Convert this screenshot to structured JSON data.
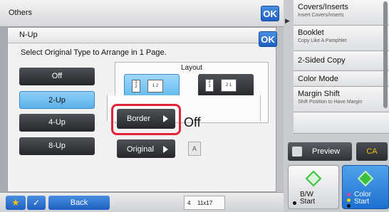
{
  "others_bar": {
    "title": "Others",
    "ok_label": "OK"
  },
  "right_panel": {
    "items": [
      {
        "label": "Covers/Inserts",
        "sublabel": "Insert Covers/Inserts"
      },
      {
        "label": "Booklet",
        "sublabel": "Copy Like A Pamphlet"
      },
      {
        "label": "2-Sided Copy",
        "sublabel": ""
      },
      {
        "label": "Color Mode",
        "sublabel": ""
      },
      {
        "label": "Margin Shift",
        "sublabel": "Shift Position to Have Margin"
      },
      {
        "label": "",
        "sublabel": ""
      }
    ],
    "preview_label": "Preview",
    "ca_label": "CA",
    "bw_start_line1": "B/W",
    "bw_start_line2": "Start",
    "color_start_line1": "Color",
    "color_start_line2": "Start"
  },
  "nup": {
    "title": "N-Up",
    "ok_label": "OK",
    "instruction": "Select Original Type to Arrange in 1 Page.",
    "types": [
      {
        "label": "Off",
        "selected": false
      },
      {
        "label": "2-Up",
        "selected": true
      },
      {
        "label": "4-Up",
        "selected": false
      },
      {
        "label": "8-Up",
        "selected": false
      }
    ],
    "layout_label": "Layout",
    "layout_options": [
      {
        "page_a": "1",
        "page_b": "2",
        "order_a": "1",
        "order_b": "2",
        "selected": true
      },
      {
        "page_a": "2",
        "page_b": "1",
        "order_a": "2",
        "order_b": "1",
        "selected": false
      }
    ],
    "border_label": "Border",
    "border_state": "Off",
    "original_label": "Original",
    "original_icon": "A"
  },
  "bottom_bar": {
    "star_icon": "★",
    "check_icon": "✓",
    "back_label": "Back",
    "paper_tray": "4",
    "paper_size": "11x17"
  },
  "colors": {
    "accent_blue": "#1e5fc2",
    "selected_light_blue": "#59b2ea",
    "highlight_red": "#e2233b",
    "start_green": "#3cbf3c",
    "ca_yellow": "#f2c200"
  }
}
